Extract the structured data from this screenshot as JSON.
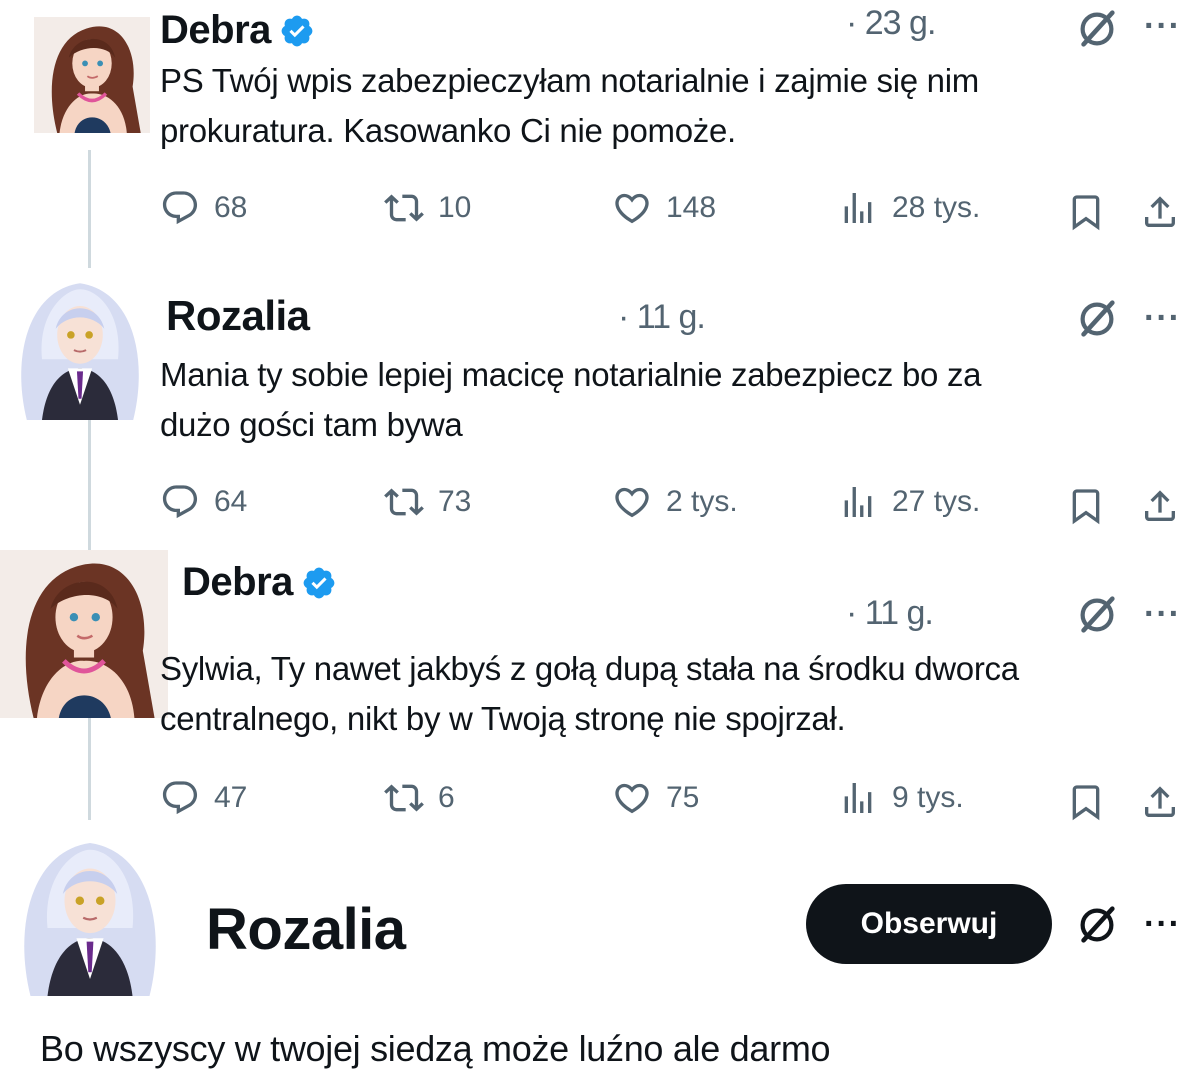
{
  "tweets": [
    {
      "author": "Debra",
      "verified": true,
      "time": "· 23 g.",
      "text_lines": [
        "PS Twój wpis zabezpieczyłam notarialnie i zajmie się nim",
        "prokuratura. Kasowanko Ci nie pomoże."
      ],
      "replies": "68",
      "reposts": "10",
      "likes": "148",
      "views": "28 tys."
    },
    {
      "author": "Rozalia",
      "verified": false,
      "time": "· 11 g.",
      "text_lines": [
        "Mania ty sobie lepiej macicę notarialnie zabezpiecz bo za",
        "dużo gości tam bywa"
      ],
      "replies": "64",
      "reposts": "73",
      "likes": "2 tys.",
      "views": "27 tys."
    },
    {
      "author": "Debra",
      "verified": true,
      "time": "· 11 g.",
      "text_lines": [
        "Sylwia, Ty nawet jakbyś z gołą dupą stała na środku dworca",
        "centralnego, nikt by w Twoją stronę nie spojrzał."
      ],
      "replies": "47",
      "reposts": "6",
      "likes": "75",
      "views": "9 tys."
    },
    {
      "author": "Rozalia",
      "verified": false,
      "follow_label": "Obserwuj",
      "text": "Bo wszyscy w twojej siedzą może luźno ale darmo"
    }
  ],
  "icons": {
    "reply": "speech-bubble-icon",
    "repost": "repost-arrows-icon",
    "like": "heart-icon",
    "views": "bar-chart-icon",
    "bookmark": "bookmark-icon",
    "share": "share-upload-icon",
    "grok": "grok-slash-circle-icon",
    "more": "ellipsis-icon"
  },
  "colors": {
    "verified_blue": "#1d9bf0",
    "muted_gray": "#536471",
    "text_black": "#0f1419",
    "follow_button": "#0f1419"
  }
}
